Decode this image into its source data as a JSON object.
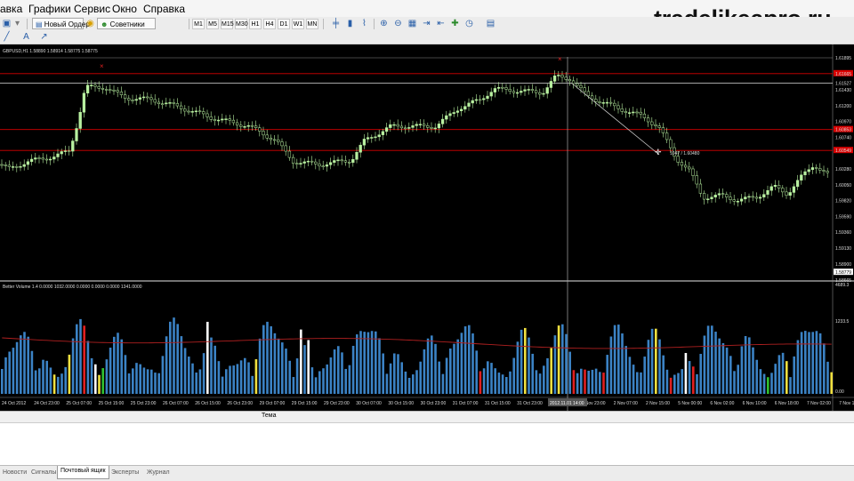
{
  "menu": [
    "авка",
    "Графики",
    "Сервис",
    "Окно",
    "Справка"
  ],
  "watermark": "tradelikeapro.ru",
  "toolbar": {
    "new_order": "Новый Ордер",
    "advisors": "Советники",
    "timeframes": [
      "M1",
      "M5",
      "M15",
      "M30",
      "H1",
      "H4",
      "D1",
      "W1",
      "MN"
    ]
  },
  "chart": {
    "title": "GBPUSD,H1  1.58890 1.58914 1.58775 1.58775",
    "crosshair_label": "1047 / 1.60480",
    "price_axis": [
      "1.61895",
      "1.61665",
      "1.61527",
      "1.61430",
      "1.61200",
      "1.60970",
      "1.60853",
      "1.60740",
      "1.60549",
      "1.60280",
      "1.60050",
      "1.59820",
      "1.59590",
      "1.59360",
      "1.59130",
      "1.58900",
      "1.58779",
      "1.58665"
    ],
    "highlighted_prices": [
      "1.61665",
      "1.60853",
      "1.60549"
    ],
    "current_price": "1.58779"
  },
  "volume": {
    "title": "Better Volume 1.4  0.0000 1032.0000 0.0000 0.0000 0.0000 1341.0000",
    "axis_top": "4689.3",
    "axis_mid": "1233.5",
    "axis_bottom": "0.00"
  },
  "time_axis": [
    "24 Oct 2012",
    "24 Oct 23:00",
    "25 Oct 07:00",
    "25 Oct 15:00",
    "25 Oct 23:00",
    "26 Oct 07:00",
    "26 Oct 15:00",
    "26 Oct 23:00",
    "29 Oct 07:00",
    "29 Oct 15:00",
    "29 Oct 23:00",
    "30 Oct 07:00",
    "30 Oct 15:00",
    "30 Oct 23:00",
    "31 Oct 07:00",
    "31 Oct 15:00",
    "31 Oct 23:00",
    "1 Nov",
    "1 Nov 23:00",
    "2 Nov 07:00",
    "2 Nov 15:00",
    "5 Nov 00:00",
    "6 Nov 02:00",
    "6 Nov 10:00",
    "6 Nov 18:00",
    "7 Nov 02:00",
    "7 Nov 10:00"
  ],
  "time_cursor": "2012.11.01 14:00",
  "terminal": {
    "column_header": "Тема",
    "tabs": [
      "Новости",
      "Сигналы",
      "Почтовый ящик",
      "Эксперты",
      "Журнал"
    ],
    "active_tab": 2
  },
  "colors": {
    "background": "#000000",
    "bull": "#b8f0a0",
    "level": "#d80000",
    "volume_blue": "#3b82c4",
    "volume_red": "#e02020",
    "volume_white": "#ffffff",
    "volume_yellow": "#f0e040",
    "volume_green": "#30c030",
    "volume_ma": "#b02020"
  }
}
